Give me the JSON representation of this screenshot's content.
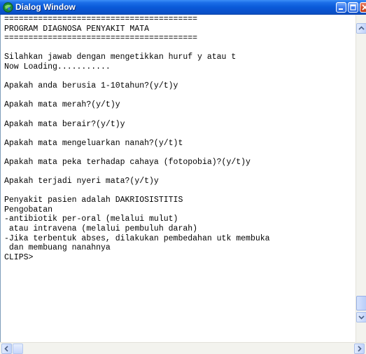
{
  "window": {
    "title": "Dialog Window",
    "icon": "clips-app-icon",
    "controls": [
      "minimize-icon",
      "maximize-icon",
      "close-icon"
    ]
  },
  "console": {
    "lines": [
      "========================================",
      "PROGRAM DIAGNOSA PENYAKIT MATA",
      "========================================",
      "",
      "Silahkan jawab dengan mengetikkan huruf y atau t",
      "Now Loading...........",
      "",
      "Apakah anda berusia 1-10tahun?(y/t)y",
      "",
      "Apakah mata merah?(y/t)y",
      "",
      "Apakah mata berair?(y/t)y",
      "",
      "Apakah mata mengeluarkan nanah?(y/t)t",
      "",
      "Apakah mata peka terhadap cahaya (fotopobia)?(y/t)y",
      "",
      "Apakah terjadi nyeri mata?(y/t)y",
      "",
      "Penyakit pasien adalah DAKRIOSISTITIS",
      "Pengobatan",
      "-antibiotik per-oral (melalui mulut)",
      " atau intravena (melalui pembuluh darah)",
      "-Jika terbentuk abses, dilakukan pembedahan utk membuka",
      " dan membuang nanahnya",
      "CLIPS>"
    ]
  },
  "scrollbars": {
    "vertical_position": 0.95,
    "horizontal_position": 0.0
  },
  "colors": {
    "titlebar": "#0a5ad9",
    "title_text": "#ffffff",
    "console_bg": "#ffffff",
    "console_text": "#000000",
    "scrollbar_track": "#f3f3ee",
    "scroll_button": "#c1d3fb"
  }
}
